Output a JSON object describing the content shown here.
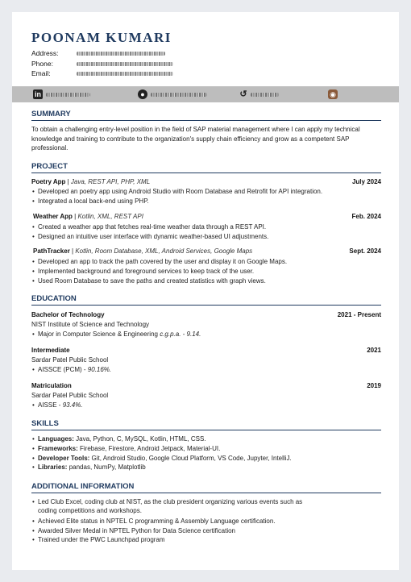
{
  "header": {
    "name": "POONAM  KUMARI",
    "address_label": "Address:",
    "phone_label": "Phone:",
    "email_label": "Email:"
  },
  "icons": [
    "linkedin-icon",
    "github-icon",
    "leetcode-icon",
    "codechef-icon"
  ],
  "summary": {
    "heading": "SUMMARY",
    "text": "To obtain a challenging entry-level position in the field of SAP material management where I can apply my technical knowledge and training to contribute to the organization's supply chain efficiency and grow as a competent SAP professional."
  },
  "project": {
    "heading": "PROJECT",
    "items": [
      {
        "title": "Poetry App",
        "sep": " | ",
        "tech": "Java, REST API, PHP, XML",
        "date": "July 2024",
        "bullets": [
          "Developed an poetry app using Android Studio with Room Database and Retrofit for API integration.",
          "Integrated a local back-end using PHP."
        ]
      },
      {
        "title": "Weather App",
        "sep": " | ",
        "tech": "Kotlin, XML, REST API",
        "date": "Feb. 2024",
        "bullets": [
          "Created a weather app that fetches real-time weather data through a REST API.",
          "Designed an intuitive user interface with dynamic weather-based UI adjustments."
        ]
      },
      {
        "title": "PathTracker",
        "sep": " | ",
        "tech": "Kotlin, Room Database, XML, Android Services, Google Maps",
        "date": "Sept. 2024",
        "bullets": [
          "Developed an app to track the path covered by the user and display it on Google Maps.",
          "Implemented background and foreground services to keep track of the user.",
          "Used Room Database to save the paths and created statistics with graph views."
        ]
      }
    ]
  },
  "education": {
    "heading": "EDUCATION",
    "items": [
      {
        "title": "Bachelor of Technology",
        "date": "2021 - Present",
        "school": "NIST Institute of Science and Technology",
        "bullet_pre": "Major in Computer Science & Engineering ",
        "bullet_em": "c.g.p.a.  -  9.14."
      },
      {
        "title": "Intermediate",
        "date": "2021",
        "school": "Sardar Patel Public School",
        "bullet_pre": "AISSCE (PCM)  -  ",
        "bullet_em": "90.16%."
      },
      {
        "title": "Matriculation",
        "date": "2019",
        "school": "Sardar Patel Public School",
        "bullet_pre": "AISSE  -  ",
        "bullet_em": "93.4%."
      }
    ]
  },
  "skills": {
    "heading": "SKILLS",
    "items": [
      {
        "label": "Languages:",
        "value": " Java, Python, C, MySQL, Kotlin, HTML, CSS."
      },
      {
        "label": "Frameworks:",
        "value": " Firebase, Firestore, Android Jetpack, Material-UI."
      },
      {
        "label": "Developer Tools:",
        "value": " Git, Android Studio, Google Cloud Platform, VS Code, Jupyter, IntelliJ."
      },
      {
        "label": "Libraries:",
        "value": " pandas, NumPy, Matplotlib"
      }
    ]
  },
  "additional": {
    "heading": "ADDITIONAL INFORMATION",
    "items": [
      "Led Club Excel, coding club at NIST, as the club president organizing various events such as",
      "coding competitions and workshops.",
      "Achieved Elite status in NPTEL C programming & Assembly Language certification.",
      "Awarded Silver Medal in NPTEL Python for Data Science certification",
      "Trained under the PWC Launchpad program"
    ]
  }
}
